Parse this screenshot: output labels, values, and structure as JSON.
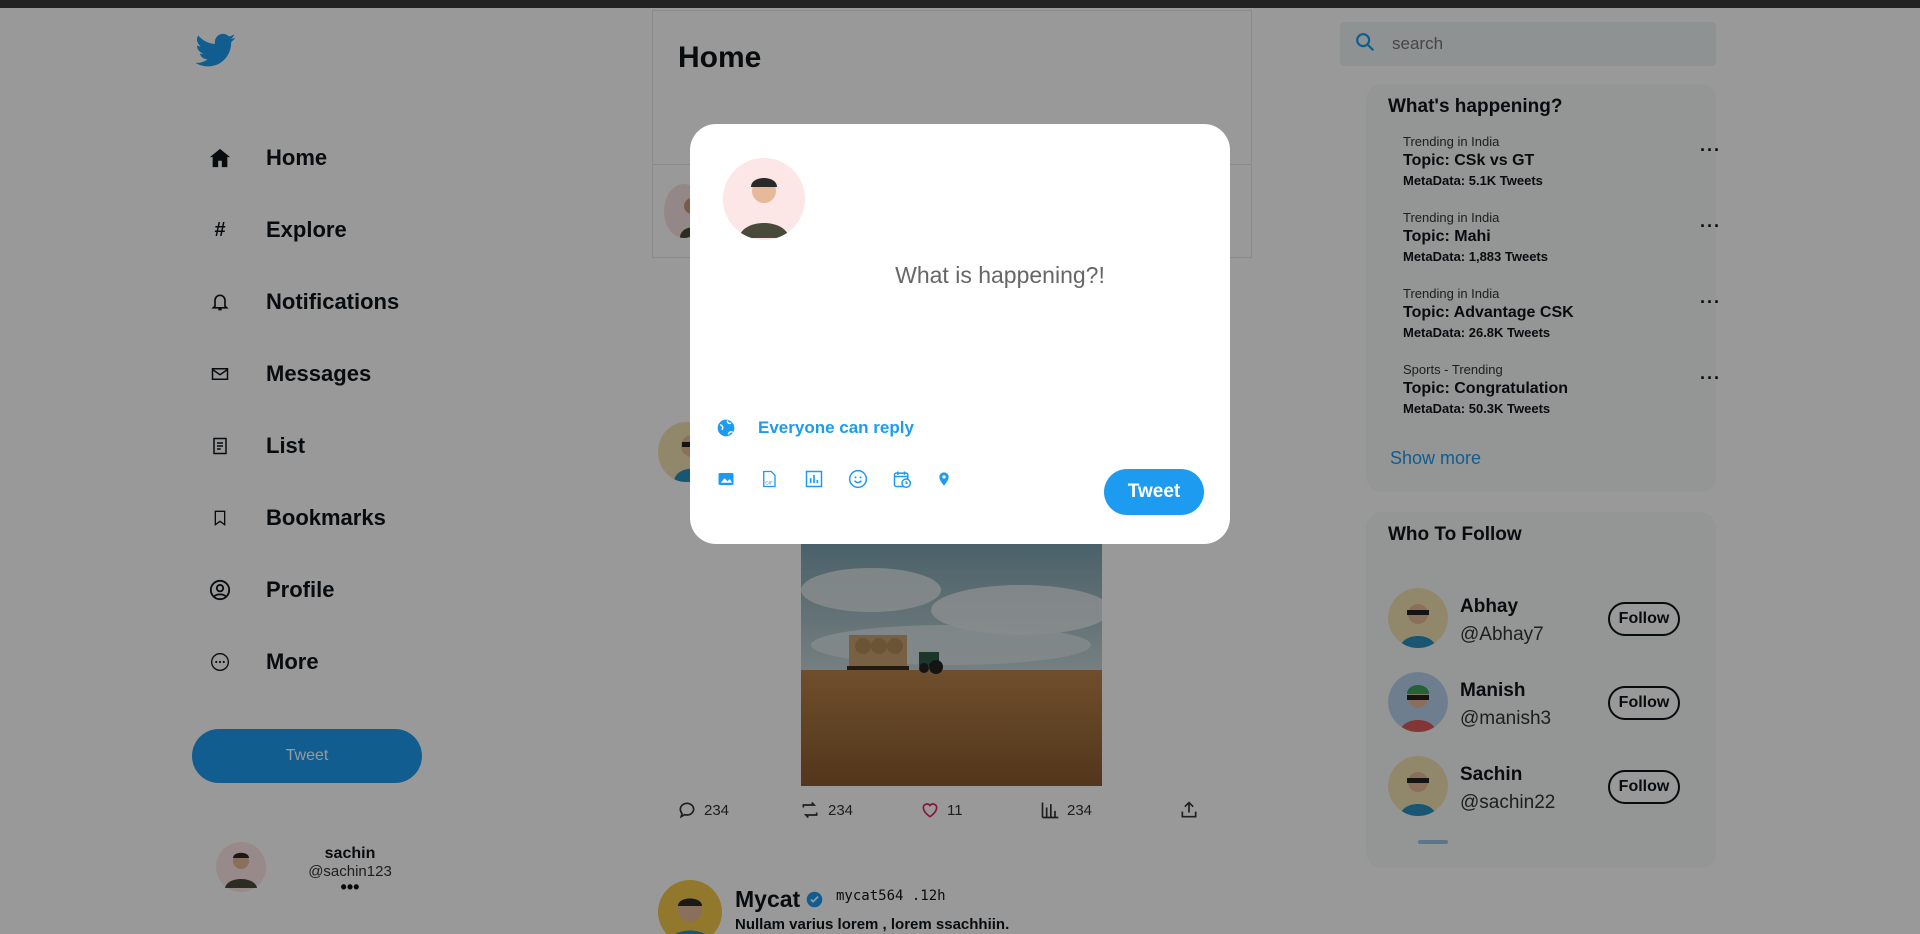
{
  "colors": {
    "accent": "#1d9bf0",
    "overlay": "rgba(0,0,0,0.40)"
  },
  "sidebar": {
    "logo": "twitter-bird-icon",
    "items": [
      {
        "label": "Home",
        "icon": "home-icon"
      },
      {
        "label": "Explore",
        "icon": "hash-icon"
      },
      {
        "label": "Notifications",
        "icon": "bell-icon"
      },
      {
        "label": "Messages",
        "icon": "mail-icon"
      },
      {
        "label": "List",
        "icon": "list-icon"
      },
      {
        "label": "Bookmarks",
        "icon": "bookmark-icon"
      },
      {
        "label": "Profile",
        "icon": "profile-icon"
      },
      {
        "label": "More",
        "icon": "more-circle-icon"
      }
    ],
    "tweet_button": "Tweet",
    "user": {
      "name": "sachin",
      "handle": "@sachin123",
      "menu": "•••"
    }
  },
  "main": {
    "title": "Home",
    "post_actions": {
      "replies": "234",
      "retweets": "234",
      "likes": "11",
      "views": "234"
    },
    "tweet2": {
      "name": "Mycat",
      "meta": "mycat564 .12h",
      "text": "Nullam varius lorem , lorem ssachhiin."
    }
  },
  "search": {
    "placeholder": "search"
  },
  "trends": {
    "title": "What's happening?",
    "items": [
      {
        "category": "Trending in India",
        "topic": "Topic: CSk vs GT",
        "meta": "MetaData: 5.1K Tweets"
      },
      {
        "category": "Trending in India",
        "topic": "Topic: Mahi",
        "meta": "MetaData: 1,883 Tweets"
      },
      {
        "category": "Trending in India",
        "topic": "Topic: Advantage CSK",
        "meta": "MetaData: 26.8K Tweets"
      },
      {
        "category": "Sports - Trending",
        "topic": "Topic: Congratulation",
        "meta": "MetaData: 50.3K Tweets"
      }
    ],
    "more_label": "···",
    "show_more": "Show more"
  },
  "who_to_follow": {
    "title": "Who To Follow",
    "users": [
      {
        "name": "Abhay",
        "handle": "@Abhay7",
        "button": "Follow"
      },
      {
        "name": "Manish",
        "handle": "@manish3",
        "button": "Follow"
      },
      {
        "name": "Sachin",
        "handle": "@sachin22",
        "button": "Follow"
      }
    ]
  },
  "compose": {
    "placeholder": "What is happening?!",
    "reply_setting": "Everyone can reply",
    "tools": [
      "image-icon",
      "gif-icon",
      "poll-icon",
      "emoji-icon",
      "schedule-icon",
      "location-icon"
    ],
    "tweet_button": "Tweet"
  }
}
